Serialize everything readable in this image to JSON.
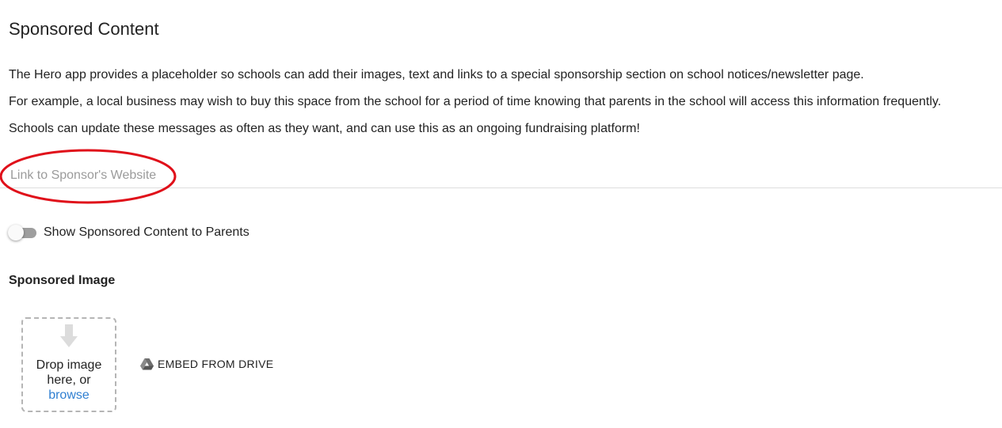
{
  "page": {
    "title": "Sponsored Content",
    "paragraphs": [
      "The Hero app provides a placeholder so schools can add their images, text and links to a special sponsorship section on school notices/newsletter page.",
      "For example, a local business may wish to buy this space from the school for a period of time knowing that parents in the school will access this information frequently.",
      "Schools can update these messages as often as they want, and can use this as an ongoing fundraising platform!"
    ]
  },
  "link_field": {
    "placeholder": "Link to Sponsor's Website",
    "value": ""
  },
  "toggle": {
    "label": "Show Sponsored Content to Parents",
    "checked": false
  },
  "image_section": {
    "heading": "Sponsored Image",
    "drop_text_line1": "Drop image",
    "drop_text_line2": "here, or",
    "browse_label": "browse",
    "embed_label": "EMBED FROM DRIVE"
  },
  "icons": {
    "drop": "arrow-down-icon",
    "drive": "google-drive-icon"
  },
  "colors": {
    "annotation": "#e0101a",
    "link": "#2f7fd1",
    "toggle_off": "#9e9e9e"
  }
}
